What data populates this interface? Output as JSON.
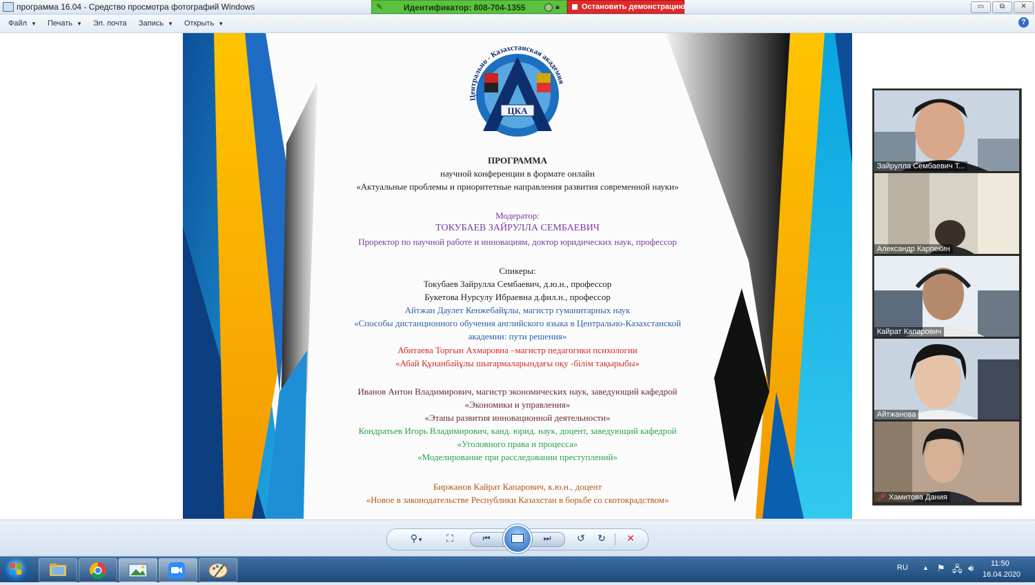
{
  "window": {
    "title": "программа 16.04 - Средство просмотра фотографий Windows",
    "share_id_label": "Идентификатор: 808-704-1355",
    "stop_share_label": "Остановить демонстрацию",
    "controls": {
      "minimize": "▭",
      "restore": "⧉",
      "close": "✕"
    }
  },
  "menu": {
    "items": [
      {
        "label": "Файл",
        "has_caret": true
      },
      {
        "label": "Печать",
        "has_caret": true
      },
      {
        "label": "Эл. почта",
        "has_caret": false
      },
      {
        "label": "Запись",
        "has_caret": true
      },
      {
        "label": "Открыть",
        "has_caret": true
      }
    ],
    "help": "?"
  },
  "slide": {
    "logo_arc_text": "Центрально - Казахстанская академия",
    "logo_center_text": "ЦКА",
    "program_title": "ПРОГРАММА",
    "subtitle": "научной конференции  в формате онлайн",
    "conference_name": "«Актуальные проблемы и приоритетные направления развития современной науки»",
    "moderator_label": "Модератор:",
    "moderator_name": "ТОКУБАЕВ ЗАЙРУЛЛА СЕМБАЕВИЧ",
    "moderator_position": "Проректор по научной работе и инновациям, доктор юридических наук, профессор",
    "speakers_label": "Спикеры:",
    "speaker_1": "Токубаев Зайрулла Сембаевич,  д.ю.н., профессор",
    "speaker_2": "Букетова Нурсулу Ибраевна д.фил.н., профессор",
    "speaker_3": "Айтжан Даулет Кенжебайұлы, магистр гуманитарных наук",
    "speaker_3_topic_1": "«Способы дистанционного обучения английского языка в Центрально-Казахстанской",
    "speaker_3_topic_2": "академии: пути решения»",
    "speaker_4": "Абитаева Торгын Ахмаровна –магистр педагогики психологии",
    "speaker_4_topic": "«Абай Құнанбайұлы шығармаларындағы оқу -білім  тақырыбы»",
    "speaker_5": "Иванов Антон Владимирович, магистр экономических наук, заведующий кафедрой",
    "speaker_5_dept": "«Экономики и управления»",
    "speaker_5_topic": "«Этапы развития инновационной деятельности»",
    "speaker_6": "Кондратьев Игорь Владимирович, канд. юрид. наук, доцент, заведующий кафедрой",
    "speaker_6_dept": "«Уголовного права и процесса»",
    "speaker_6_topic": "«Моделирование при расследовании преступлений»",
    "speaker_7": "Биржанов Кайрат Капарович, к.ю.н., доцент",
    "speaker_7_topic": "«Новое в законодательстве Республики Казахстан в борьбе со скотокрадством»"
  },
  "participants": [
    {
      "name": "Зайрулла Сембаевич Т...",
      "muted": false
    },
    {
      "name": "Александр Карпекин",
      "muted": false
    },
    {
      "name": "Кайрат Капарович",
      "muted": false
    },
    {
      "name": "Айтжанова",
      "muted": false
    },
    {
      "name": "Хамитова Дания",
      "muted": true
    }
  ],
  "viewer_toolbar": {
    "zoom": "zoom-icon",
    "fit": "fit-window-icon",
    "previous": "previous-icon",
    "slideshow": "slideshow-icon",
    "next": "next-icon",
    "rotate_ccw": "rotate-left-icon",
    "rotate_cw": "rotate-right-icon",
    "delete": "delete-icon"
  },
  "taskbar": {
    "apps": [
      "explorer-icon",
      "chrome-icon",
      "photo-viewer-icon",
      "zoom-app-icon",
      "paint-icon"
    ],
    "language": "RU",
    "time": "11:50",
    "date": "16.04.2020"
  },
  "colors": {
    "accent_blue": "#1e90d6",
    "accent_yellow": "#f7b500",
    "share_green": "#5cc040",
    "stop_red": "#e02a2a"
  }
}
